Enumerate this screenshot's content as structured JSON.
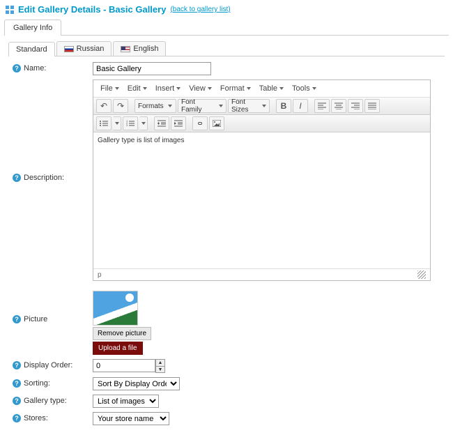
{
  "header": {
    "title": "Edit Gallery Details - Basic Gallery",
    "back_link": "(back to gallery list)"
  },
  "main_tab": "Gallery Info",
  "lang_tabs": {
    "standard": "Standard",
    "russian": "Russian",
    "english": "English"
  },
  "fields": {
    "name_label": "Name:",
    "name_value": "Basic Gallery",
    "description_label": "Description:",
    "description_value": "Gallery type is list of images",
    "picture_label": "Picture",
    "remove_picture": "Remove picture",
    "upload_file": "Upload a file",
    "display_order_label": "Display Order:",
    "display_order_value": "0",
    "sorting_label": "Sorting:",
    "sorting_value": "Sort By Display Order",
    "gallery_type_label": "Gallery type:",
    "gallery_type_value": "List of images",
    "stores_label": "Stores:",
    "stores_value": "Your store name"
  },
  "editor": {
    "menu": {
      "file": "File",
      "edit": "Edit",
      "insert": "Insert",
      "view": "View",
      "format": "Format",
      "table": "Table",
      "tools": "Tools"
    },
    "formats": "Formats",
    "font_family": "Font Family",
    "font_sizes": "Font Sizes",
    "status_path": "p"
  }
}
